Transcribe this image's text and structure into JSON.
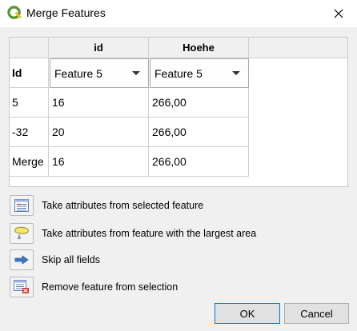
{
  "window": {
    "title": "Merge Features"
  },
  "table": {
    "columns": [
      "id",
      "Hoehe"
    ],
    "header_row": {
      "label": "Id",
      "combos": [
        "Feature 5",
        "Feature 5"
      ]
    },
    "rows": [
      {
        "label": "5",
        "values": [
          "16",
          "266,00"
        ]
      },
      {
        "label": "-32",
        "values": [
          "20",
          "266,00"
        ]
      },
      {
        "label": "Merge",
        "values": [
          "16",
          "266,00"
        ]
      }
    ]
  },
  "actions": [
    {
      "label": "Take attributes from selected feature",
      "icon": "attribute-table-icon"
    },
    {
      "label": "Take attributes from feature with the largest area",
      "icon": "largest-area-icon"
    },
    {
      "label": "Skip all fields",
      "icon": "arrow-right-icon"
    },
    {
      "label": "Remove feature from selection",
      "icon": "remove-feature-icon"
    }
  ],
  "buttons": {
    "ok": "OK",
    "cancel": "Cancel"
  },
  "colors": {
    "qgis_green": "#589632",
    "qgis_yellow": "#ee7913",
    "arrow_blue": "#3c78c8",
    "remove_red": "#d9302b",
    "focus_blue": "#0078d7"
  }
}
